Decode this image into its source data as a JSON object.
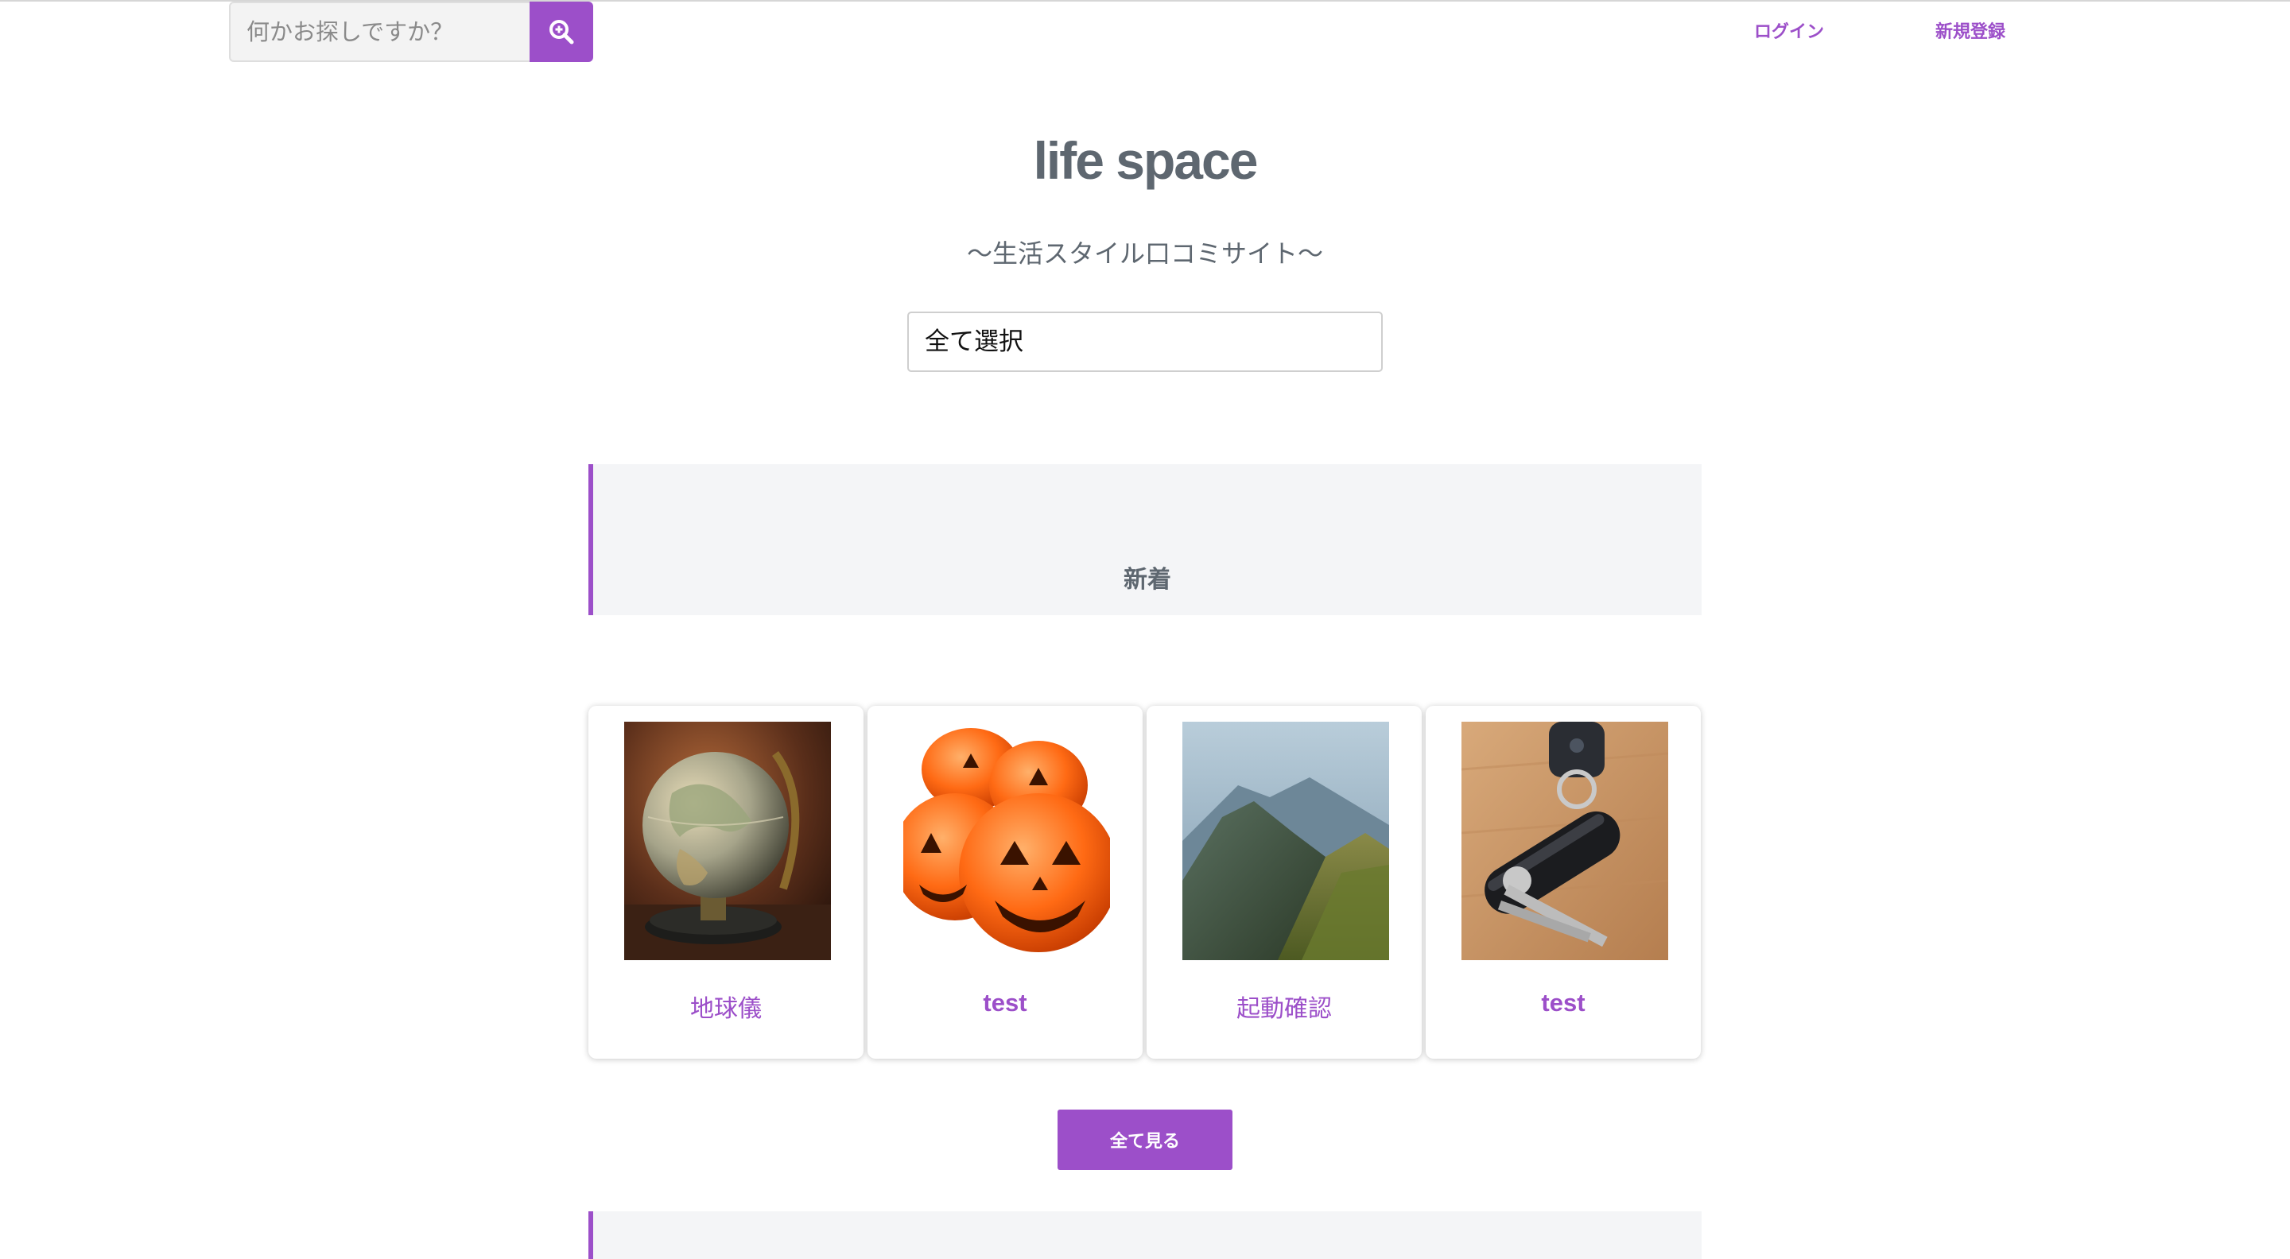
{
  "header": {
    "search": {
      "placeholder": "何かお探しですか？",
      "value": ""
    },
    "login_label": "ログイン",
    "signup_label": "新規登録"
  },
  "hero": {
    "title": "life space",
    "tagline": "〜生活スタイル口コミサイト〜",
    "category_select": {
      "selected": "全て選択"
    }
  },
  "sections": [
    {
      "title": "新着",
      "cards": [
        {
          "title": "地球儀",
          "image": "globe-image"
        },
        {
          "title": "test",
          "image": "jack-o-lantern-image"
        },
        {
          "title": "起動確認",
          "image": "mountain-image"
        },
        {
          "title": "test",
          "image": "car-keys-image"
        }
      ],
      "view_all_label": "全て見る"
    }
  ],
  "colors": {
    "accent": "#9c4fc9",
    "text": "#5e6770",
    "section_bg": "#f4f5f7"
  }
}
